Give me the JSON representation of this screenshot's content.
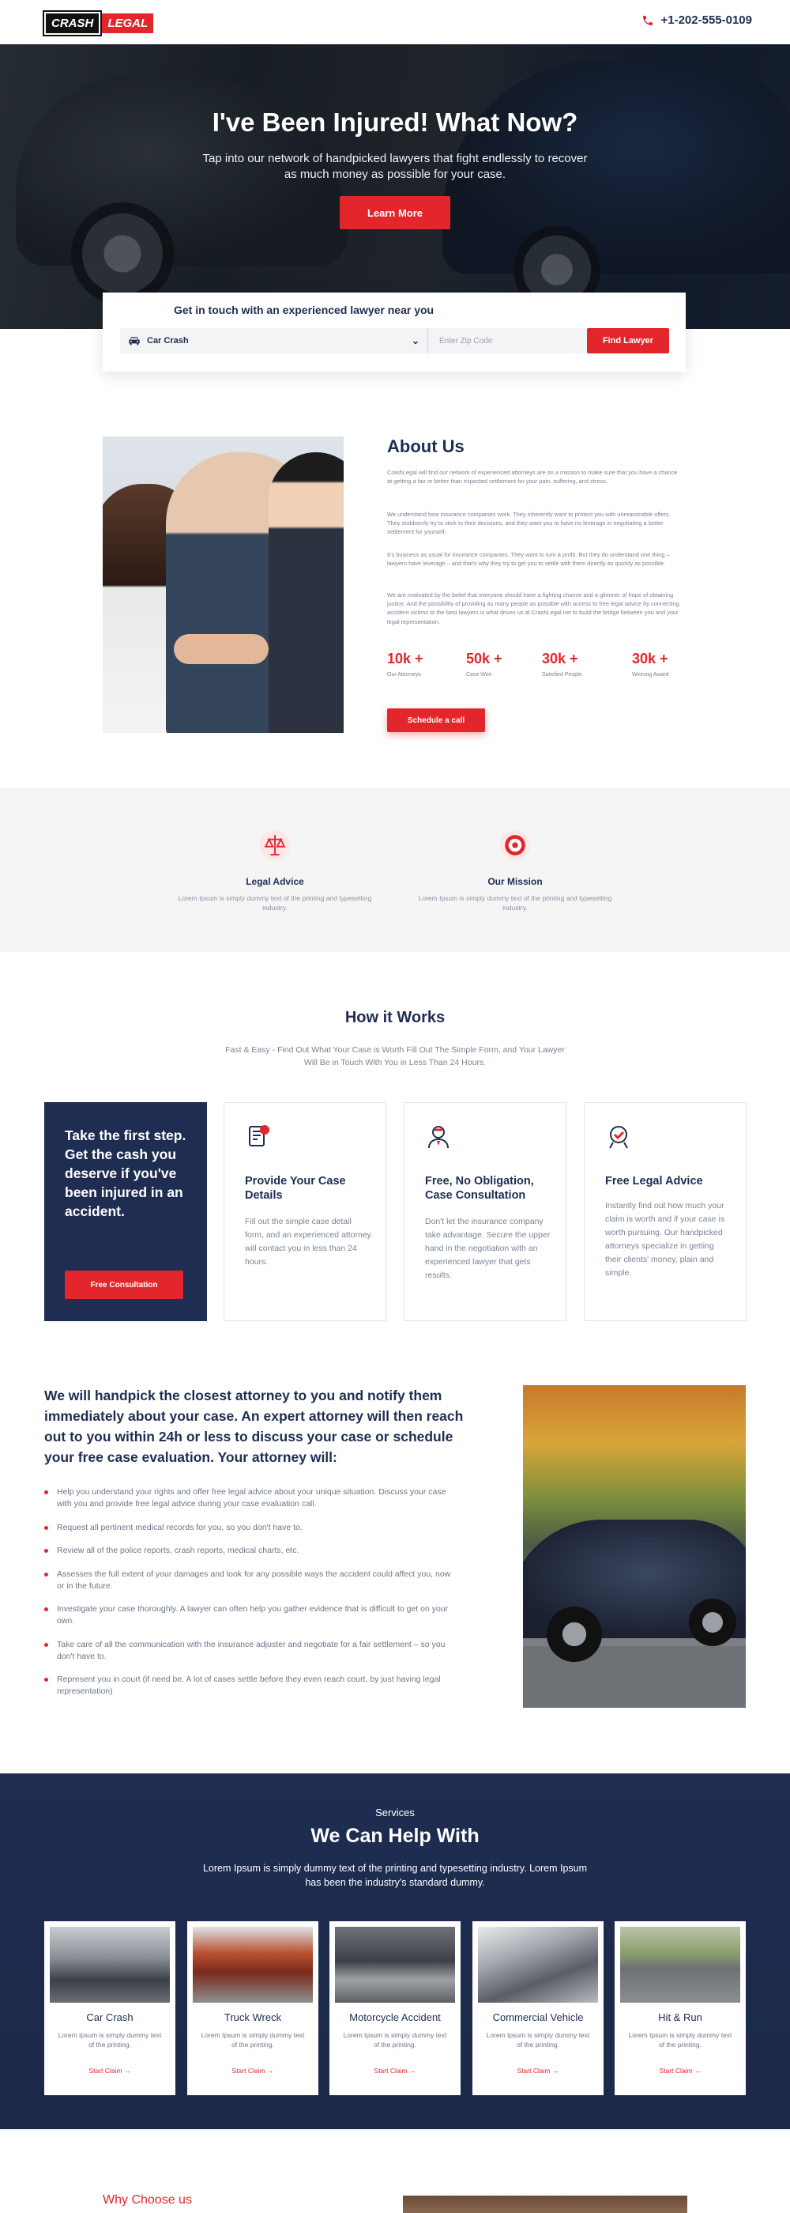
{
  "header": {
    "logo_part1": "CRASH",
    "logo_part2": "LEGAL",
    "phone": "+1-202-555-0109"
  },
  "hero": {
    "title": "I've Been Injured! What Now?",
    "subtitle": "Tap into our network of handpicked lawyers that fight endlessly to recover as much money as possible for your case.",
    "button": "Learn More"
  },
  "search": {
    "title": "Get in touch with an experienced lawyer near you",
    "select_value": "Car Crash",
    "zip_placeholder": "Enter Zip Code",
    "button": "Find Lawyer"
  },
  "about": {
    "title": "About Us",
    "paragraphs": [
      "CrashLegal will find our network of experienced attorneys are on a mission to make sure that you have a chance at getting a fair or better than expected settlement for your pain, suffering, and stress.",
      "We understand how insurance companies work. They inherently want to protect you with unreasonable offers. They stubbornly try to stick to their decisions, and they want you to have no leverage in negotiating a better settlement for yourself.",
      "It's business as usual for insurance companies. They want to turn a profit. But they do understand one thing – lawyers have leverage – and that's why they try to get you to settle with them directly as quickly as possible.",
      "We are motivated by the belief that everyone should have a fighting chance and a glimmer of hope of obtaining justice. And the possibility of providing as many people as possible with access to free legal advice by connecting accident victims to the best lawyers is what drives us at CrashLegal.net to build the bridge between you and your legal representation."
    ],
    "stats": [
      {
        "value": "10k +",
        "label": "Our Attorneys"
      },
      {
        "value": "50k +",
        "label": "Case Won"
      },
      {
        "value": "30k +",
        "label": "Satisfied People"
      },
      {
        "value": "30k +",
        "label": "Winning Award"
      }
    ],
    "button": "Schedule a call"
  },
  "features": [
    {
      "title": "Legal Advice",
      "text": "Lorem Ipsum is simply dummy text of the printing and typesetting industry.",
      "icon": "scales-icon"
    },
    {
      "title": "Our Mission",
      "text": "Lorem Ipsum is simply dummy text of the printing and typesetting industry.",
      "icon": "target-icon"
    }
  ],
  "how": {
    "title": "How it Works",
    "subtitle": "Fast & Easy - Find Out What Your Case is Worth Fill Out The Simple Form, and Your Lawyer Will Be in Touch With You in Less Than 24 Hours.",
    "cta_text": "Take the first step. Get the cash you deserve if you've been injured in an accident.",
    "cta_button": "Free Consultation",
    "steps": [
      {
        "title": "Provide Your Case Details",
        "text": "Fill out the simple case detail form, and an experienced attorney will contact you in less than 24 hours.",
        "icon": "document-icon"
      },
      {
        "title": "Free, No Obligation, Case Consultation",
        "text": "Don't let the insurance company take advantage. Secure the upper hand in the negotiation with an experienced lawyer that gets results.",
        "icon": "lawyer-icon"
      },
      {
        "title": "Free Legal Advice",
        "text": "Instantly find out how much your claim is worth and if your case is worth pursuing. Our handpicked attorneys specialize in getting their clients' money, plain and simple.",
        "icon": "advice-icon"
      }
    ]
  },
  "handpick": {
    "title": "We will handpick the closest attorney to you and notify them immediately about your case. An expert attorney will then reach out to you within 24h or less to discuss your case or schedule your free case evaluation. Your attorney will:",
    "items": [
      "Help you understand your rights and offer free legal advice about your unique situation. Discuss your case with you and provide free legal advice during your case evaluation call.",
      "Request all pertinent medical records for you, so you don't have to.",
      "Review all of the police reports, crash reports, medical charts, etc.",
      "Assesses the full extent of your damages and look for any possible ways the accident could affect you, now or in the future.",
      "Investigate your case thoroughly. A lawyer can often help you gather evidence that is difficult to get on your own.",
      "Take care of all the communication with the insurance adjuster and negotiate for a fair settlement – so you don't have to.",
      "Represent you in court (if need be. A lot of cases settle before they even reach court, by just having legal representation)"
    ]
  },
  "services": {
    "kicker": "Services",
    "title": "We Can Help With",
    "subtitle": "Lorem Ipsum is simply dummy text of the printing and typesetting industry. Lorem Ipsum has been the industry's standard dummy.",
    "cards": [
      {
        "title": "Car Crash",
        "text": "Lorem Ipsum is simply dummy text of the printing.",
        "link": "Start Claim"
      },
      {
        "title": "Truck Wreck",
        "text": "Lorem Ipsum is simply dummy text of the printing.",
        "link": "Start Claim"
      },
      {
        "title": "Motorcycle Accident",
        "text": "Lorem Ipsum is simply dummy text of the printing.",
        "link": "Start Claim"
      },
      {
        "title": "Commercial Vehicle",
        "text": "Lorem Ipsum is simply dummy text of the printing.",
        "link": "Start Claim"
      },
      {
        "title": "Hit & Run",
        "text": "Lorem Ipsum is simply dummy text of the printing.",
        "link": "Start Claim"
      }
    ]
  },
  "why": {
    "title": "Why Choose us"
  },
  "colors": {
    "brand_red": "#e3262b",
    "navy": "#1f2d52"
  }
}
